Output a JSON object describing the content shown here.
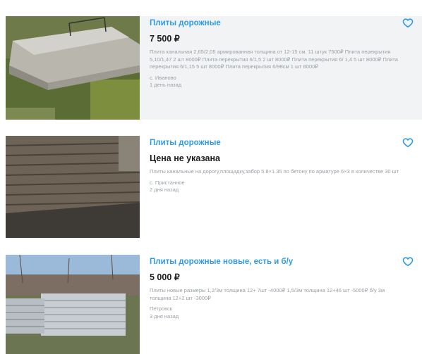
{
  "listings": [
    {
      "title": "Плиты дорожные",
      "price": "7 500 ₽",
      "description": "Плита канальная 2,65/2,05 армированная толщина от 12-15 см. 11 штук 7500₽ Плита перекрытия 5,10/1,47 2 шт 8000₽ Плита перекрытия 6/1,5 2 шт 8000₽ Плита перекрытия 6/ 1,4 5 шт 8000₽ Плита перекрытия 6/1,15 5 шт 8000₽ Плита перекрытия 6/98см 1 шт 8000₽",
      "location": "с. Иваново",
      "time": "1 день назад",
      "icon": "heart-icon"
    },
    {
      "title": "Плиты дорожные",
      "price": "Цена не указана",
      "description": "Плиты канальные на дорогу,площадку,забор 5.8×1.35 по бетону по арматуре 6×3 в количестве 30 шт",
      "location": "с. Пристанное",
      "time": "2 дня назад",
      "icon": "heart-icon"
    },
    {
      "title": "Плиты дорожные новые, есть и б/у",
      "price": "5 000 ₽",
      "description": "Плиты новые размеры 1,2/3м толщина 12+ 7шт -4000₽ 1,5/3м толщина 12+46 шт -5000₽ б/у 3м толщина 12+2 шт -3000₽",
      "location": "Петровск",
      "time": "3 дня назад",
      "icon": "heart-icon"
    }
  ],
  "colors": {
    "accent": "#2e9be6",
    "muted": "#9aa0a6",
    "highlight_bg": "#f2f3f5"
  }
}
